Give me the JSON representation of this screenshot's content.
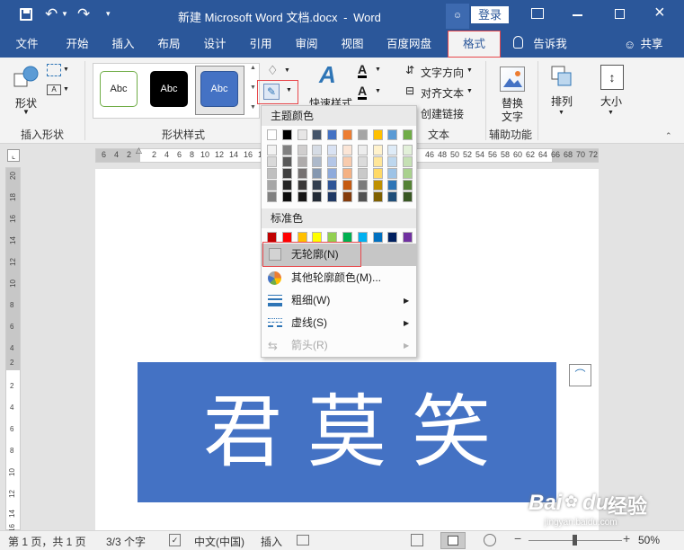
{
  "title_bar": {
    "doc_title": "新建 Microsoft Word 文档.docx",
    "separator": "-",
    "app_name": "Word",
    "login_label": "登录"
  },
  "tabs": {
    "file": "文件",
    "home": "开始",
    "insert": "插入",
    "layout": "布局",
    "design": "设计",
    "references": "引用",
    "review": "审阅",
    "view": "视图",
    "netdisk": "百度网盘",
    "format": "格式",
    "tell_me": "告诉我",
    "share": "共享"
  },
  "ribbon": {
    "shape_label": "形状",
    "insert_shape_group": "插入形状",
    "style_sample": "Abc",
    "shape_styles_group": "形状样式",
    "quick_styles": "快速样式",
    "text_direction": "文字方向",
    "align_text": "对齐文本",
    "create_link": "创建链接",
    "text_group": "文本",
    "alt_text_1": "替换",
    "alt_text_2": "文字",
    "accessibility_group": "辅助功能",
    "arrange": "排列",
    "size": "大小"
  },
  "ruler": {
    "h_left_ticks": [
      "6",
      "4",
      "2",
      "2",
      "4",
      "6",
      "8",
      "10",
      "12",
      "14",
      "16",
      "18"
    ],
    "h_right_ticks": [
      "46",
      "48",
      "50",
      "52",
      "54",
      "56",
      "58",
      "60",
      "62",
      "64",
      "66",
      "68",
      "70",
      "72"
    ],
    "v_ticks": [
      "20",
      "18",
      "16",
      "14",
      "12",
      "10",
      "8",
      "6",
      "4",
      "2",
      "2",
      "4",
      "6",
      "8",
      "10",
      "12",
      "14",
      "16"
    ]
  },
  "dropdown": {
    "theme_colors_header": "主题颜色",
    "theme_top_row": [
      "#ffffff",
      "#000000",
      "#e7e6e6",
      "#44546a",
      "#4472c4",
      "#ed7d31",
      "#a5a5a5",
      "#ffc000",
      "#5b9bd5",
      "#70ad47"
    ],
    "theme_tints": [
      [
        "#f2f2f2",
        "#d9d9d9",
        "#bfbfbf",
        "#a6a6a6",
        "#808080"
      ],
      [
        "#808080",
        "#595959",
        "#404040",
        "#262626",
        "#0d0d0d"
      ],
      [
        "#d0cece",
        "#aeabab",
        "#757171",
        "#3a3838",
        "#171616"
      ],
      [
        "#d6dce5",
        "#adb9ca",
        "#8497b0",
        "#333f50",
        "#222a35"
      ],
      [
        "#d9e2f3",
        "#b4c6e7",
        "#8eaadb",
        "#2f5597",
        "#1f3864"
      ],
      [
        "#fbe5d6",
        "#f8cbad",
        "#f4b183",
        "#c55a11",
        "#843c0c"
      ],
      [
        "#ededed",
        "#dbdbdb",
        "#c9c9c9",
        "#7b7b7b",
        "#525252"
      ],
      [
        "#fff2cc",
        "#ffe699",
        "#ffd966",
        "#bf9000",
        "#7f6000"
      ],
      [
        "#deebf7",
        "#bdd7ee",
        "#9dc3e6",
        "#2e75b6",
        "#1f4e79"
      ],
      [
        "#e2f0d9",
        "#c5e0b4",
        "#a9d18e",
        "#548235",
        "#385723"
      ]
    ],
    "standard_colors_header": "标准色",
    "standard_colors": [
      "#c00000",
      "#ff0000",
      "#ffc000",
      "#ffff00",
      "#92d050",
      "#00b050",
      "#00b0f0",
      "#0070c0",
      "#002060",
      "#7030a0"
    ],
    "no_outline": "无轮廓(N)",
    "more_colors": "其他轮廓颜色(M)...",
    "weight": "粗细(W)",
    "dashes": "虚线(S)",
    "arrows": "箭头(R)"
  },
  "document": {
    "shape_text": "君 莫 笑",
    "shape_fill": "#4472c4"
  },
  "status_bar": {
    "page": "第 1 页，共 1 页",
    "words": "3/3 个字",
    "language": "中文(中国)",
    "mode": "插入",
    "zoom": "50%"
  },
  "watermark": {
    "brand": "Bai",
    "brand2": "du",
    "product": "经验",
    "url": "jingyan.baidu.com"
  },
  "colors": {
    "accent": "#2b579a",
    "highlight_red": "#e8474b"
  }
}
